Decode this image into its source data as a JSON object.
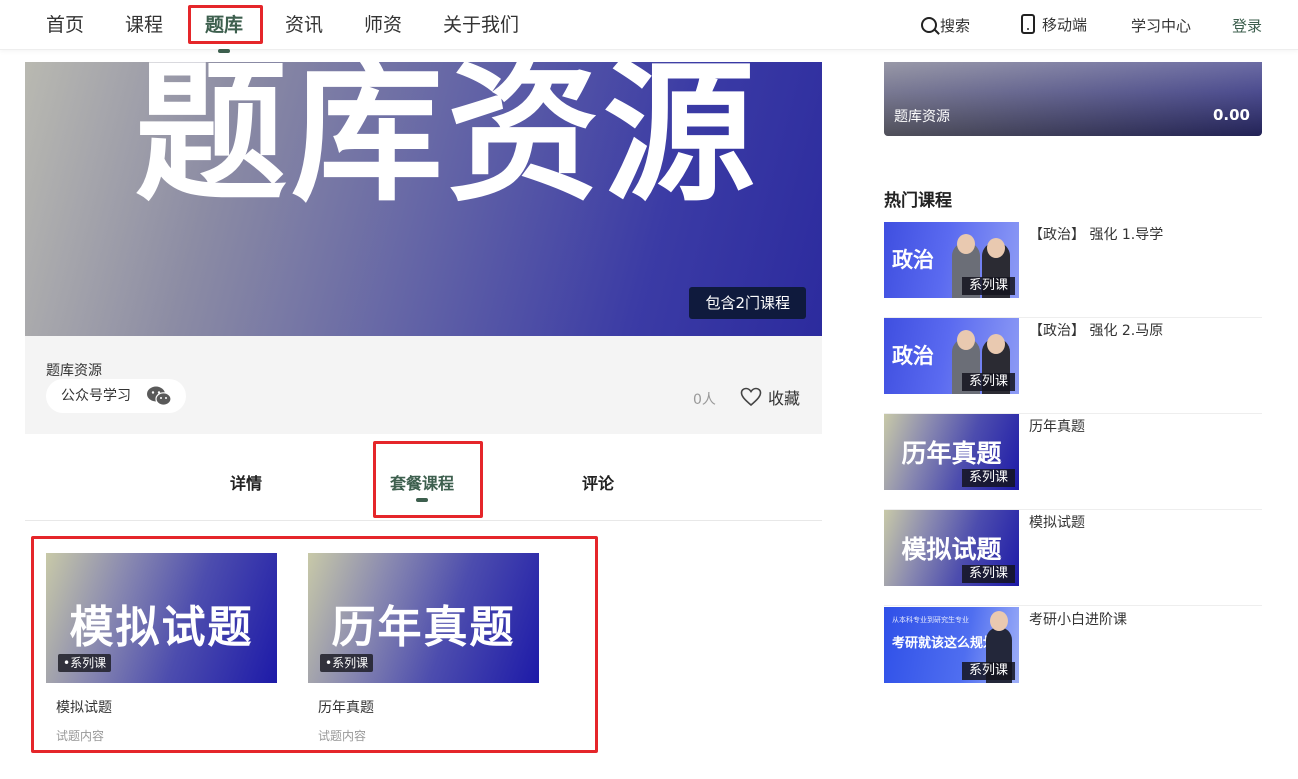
{
  "nav": {
    "items": [
      {
        "label": "首页"
      },
      {
        "label": "课程"
      },
      {
        "label": "题库"
      },
      {
        "label": "资讯"
      },
      {
        "label": "师资"
      },
      {
        "label": "关于我们"
      }
    ],
    "active_index": 2,
    "search": "搜索",
    "mobile": "移动端",
    "study_center": "学习中心",
    "login": "登录"
  },
  "hero": {
    "image_text": "题库资源",
    "badge": "包含2门课程"
  },
  "info": {
    "title": "题库资源",
    "wechat_pill": "公众号学习",
    "people_count": "0人",
    "favorite": "收藏"
  },
  "tabs": [
    {
      "label": "详情"
    },
    {
      "label": "套餐课程"
    },
    {
      "label": "评论"
    }
  ],
  "active_tab": 1,
  "package_courses": [
    {
      "image_text": "模拟试题",
      "tag": "•系列课",
      "title": "模拟试题",
      "desc": "试题内容"
    },
    {
      "image_text": "历年真题",
      "tag": "•系列课",
      "title": "历年真题",
      "desc": "试题内容"
    }
  ],
  "sidebar": {
    "banner_title": "题库资源",
    "banner_price": "0.00",
    "hot_title": "热门课程",
    "hot_courses": [
      {
        "name": "【政治】 强化 1.导学",
        "thumb_text": "政治",
        "tag": "系列课"
      },
      {
        "name": "【政治】 强化 2.马原",
        "thumb_text": "政治",
        "tag": "系列课"
      },
      {
        "name": "历年真题",
        "thumb_text": "历年真题",
        "tag": "系列课"
      },
      {
        "name": "模拟试题",
        "thumb_text": "模拟试题",
        "tag": "系列课"
      },
      {
        "name": "考研小白进阶课",
        "thumb_text": "考研就该这么规划",
        "thumb_top": "从本科专业到研究生专业",
        "tag": "系列课"
      }
    ]
  },
  "colors": {
    "accent": "#3d5f4e",
    "highlight_box": "#e5262a",
    "hero_badge": "#0f1a3d"
  }
}
